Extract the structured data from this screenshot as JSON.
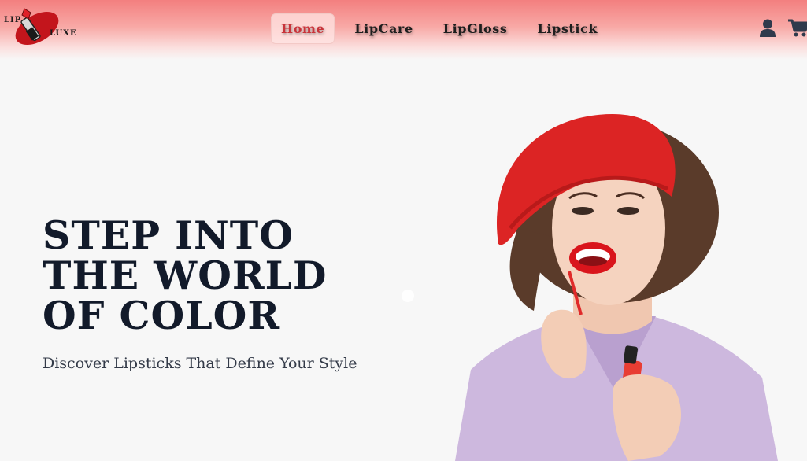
{
  "brand": {
    "logo_word_1": "LIP",
    "logo_word_2": "LUXE"
  },
  "nav": {
    "items": [
      {
        "label": "Home",
        "active": true
      },
      {
        "label": "LipCare",
        "active": false
      },
      {
        "label": "LipGloss",
        "active": false
      },
      {
        "label": "Lipstick",
        "active": false
      }
    ]
  },
  "header_icons": [
    "user-icon",
    "cart-icon"
  ],
  "hero": {
    "title_line_1": "STEP INTO",
    "title_line_2": "THE WORLD",
    "title_line_3": "OF COLOR",
    "subtitle": "Discover Lipsticks That Define Your Style"
  },
  "colors": {
    "accent": "#c9333a",
    "header_top": "#f37f7f",
    "title": "#121a2a",
    "background": "#f7f7f7"
  }
}
